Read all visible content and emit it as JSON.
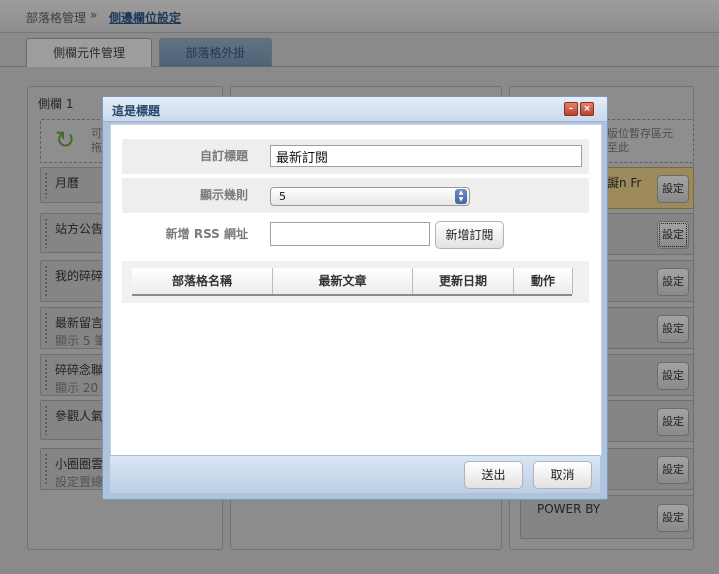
{
  "breadcrumb": {
    "parent": "部落格管理",
    "separator": "»",
    "current": "側邊欄位設定"
  },
  "tabs": [
    {
      "label": "側欄元件管理"
    },
    {
      "label": "部落格外掛"
    }
  ],
  "left_column": {
    "title": "側欄 1",
    "hint_line1": "可",
    "hint_line2": "拖",
    "items": [
      {
        "title": "月曆",
        "sub": ""
      },
      {
        "title": "站方公告",
        "sub": ""
      },
      {
        "title": "我的碎碎",
        "sub": ""
      },
      {
        "title": "最新留言",
        "sub": "顯示 5 筆"
      },
      {
        "title": "碎碎念聯",
        "sub": "顯示 20"
      },
      {
        "title": "參觀人氣",
        "sub": ""
      },
      {
        "title": "小圈圈雲",
        "sub": "設定置總"
      }
    ]
  },
  "right_column": {
    "hint_line1": "版位暫存區元",
    "hint_line2": "至此",
    "items": [
      {
        "title": "譺n Fr",
        "button": "設定"
      },
      {
        "title": "",
        "button": "設定"
      },
      {
        "title": "",
        "button": "設定"
      },
      {
        "title": "",
        "button": "設定"
      },
      {
        "title": "",
        "button": "設定"
      },
      {
        "title": "",
        "button": "設定"
      },
      {
        "title": "",
        "button": "設定"
      },
      {
        "title": "POWER BY",
        "button": "設定"
      }
    ]
  },
  "dialog": {
    "title": "這是標題",
    "custom_title_label": "自訂標題",
    "custom_title_value": "最新訂閱",
    "display_count_label": "顯示幾則",
    "display_count_value": "5",
    "rss_label": "新增 RSS 網址",
    "rss_value": "",
    "subscribe_button": "新增訂閱",
    "table_headers": [
      "部落格名稱",
      "最新文章",
      "更新日期",
      "動作"
    ],
    "submit_button": "送出",
    "cancel_button": "取消"
  }
}
